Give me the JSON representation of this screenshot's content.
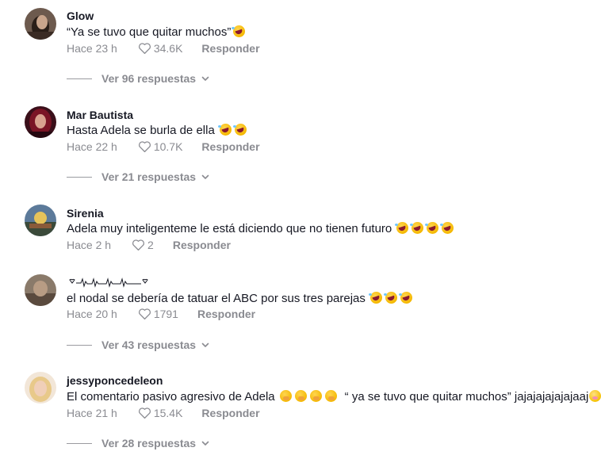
{
  "comments": [
    {
      "username": "Glow",
      "text": "“Ya se tuvo que quitar muchos”",
      "emojis": [
        "rofl"
      ],
      "time": "Hace 23 h",
      "likes": "34.6K",
      "reply_label": "Responder",
      "replies_label": "Ver 96 respuestas"
    },
    {
      "username": "Mar Bautista",
      "text": "Hasta Adela se burla de ella",
      "emojis": [
        "rofl",
        "rofl"
      ],
      "time": "Hace 22 h",
      "likes": "10.7K",
      "reply_label": "Responder",
      "replies_label": "Ver 21 respuestas"
    },
    {
      "username": "Sirenia",
      "text": "Adela muy inteligenteme le está diciendo que no tienen futuro",
      "emojis": [
        "rofl",
        "rofl",
        "rofl",
        "rofl"
      ],
      "time": "Hace 2 h",
      "likes": "2",
      "reply_label": "Responder"
    },
    {
      "username": "♡-𝓐-𝓐-𝓐♡",
      "text": "el nodal se debería de tatuar el ABC por sus tres parejas",
      "emojis": [
        "rofl",
        "rofl",
        "rofl"
      ],
      "time": "Hace 20 h",
      "likes": "1791",
      "reply_label": "Responder",
      "replies_label": "Ver 43 respuestas"
    },
    {
      "username": "jessyponcedeleon",
      "text": "El comentario pasivo agresivo de Adela",
      "text2": "“ ya se tuvo que quitar muchos” jajajajajajajaaj",
      "emojis": [
        "hush",
        "hush",
        "hush",
        "hush"
      ],
      "emoji_end": "zipper",
      "time": "Hace 21 h",
      "likes": "15.4K",
      "reply_label": "Responder",
      "replies_label": "Ver 28 respuestas"
    }
  ]
}
